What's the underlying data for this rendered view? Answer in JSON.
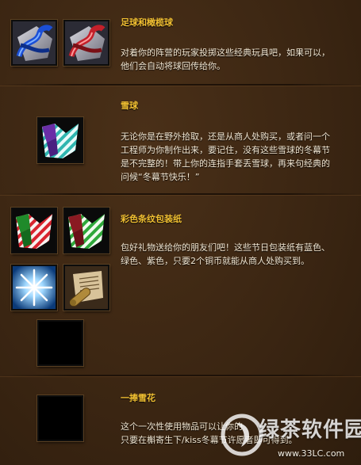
{
  "sections": [
    {
      "title": "足球和橄榄球",
      "desc": [
        "对着你的阵营的玩家投掷这些经典玩具吧，如果可以，",
        "他们会自动将球回传给你。"
      ],
      "icons": [
        "blue-ribbon-ball-icon",
        "red-ribbon-ball-icon"
      ]
    },
    {
      "title": "雪球",
      "desc": [
        "无论你是在野外拾取，还是从商人处购买，或者问一个",
        "工程师为你制作出来，要记住，没有这些雪球的冬幕节",
        "是不完整的！带上你的连指手套丢雪球，再来句经典的",
        "问候“冬幕节快乐！”"
      ],
      "icons": [
        "teal-striped-wrap-icon"
      ]
    },
    {
      "title": "彩色条纹包装纸",
      "desc": [
        "包好礼物送给你的朋友们吧！这些节日包装纸有蓝色、",
        "绿色、紫色，只要2个铜币就能从商人处购买到。"
      ],
      "icons": [
        "red-striped-wrap-icon",
        "green-striped-wrap-icon",
        "snowflake-burst-icon",
        "scroll-icon",
        "blank-slot-icon"
      ]
    },
    {
      "title": "一捧雪花",
      "desc": [
        "这个一次性使用物品可以让你的",
        "只要在槲寄生下/kiss冬幕节许愿者即可得到。"
      ],
      "icons": [
        "blank-slot-icon"
      ]
    }
  ],
  "watermark": {
    "brand": "绿茶软件园",
    "url": "www.33LC.com"
  },
  "colors": {
    "background": "#3b2613",
    "title": "#f2c032",
    "text": "#f3e7d2"
  }
}
